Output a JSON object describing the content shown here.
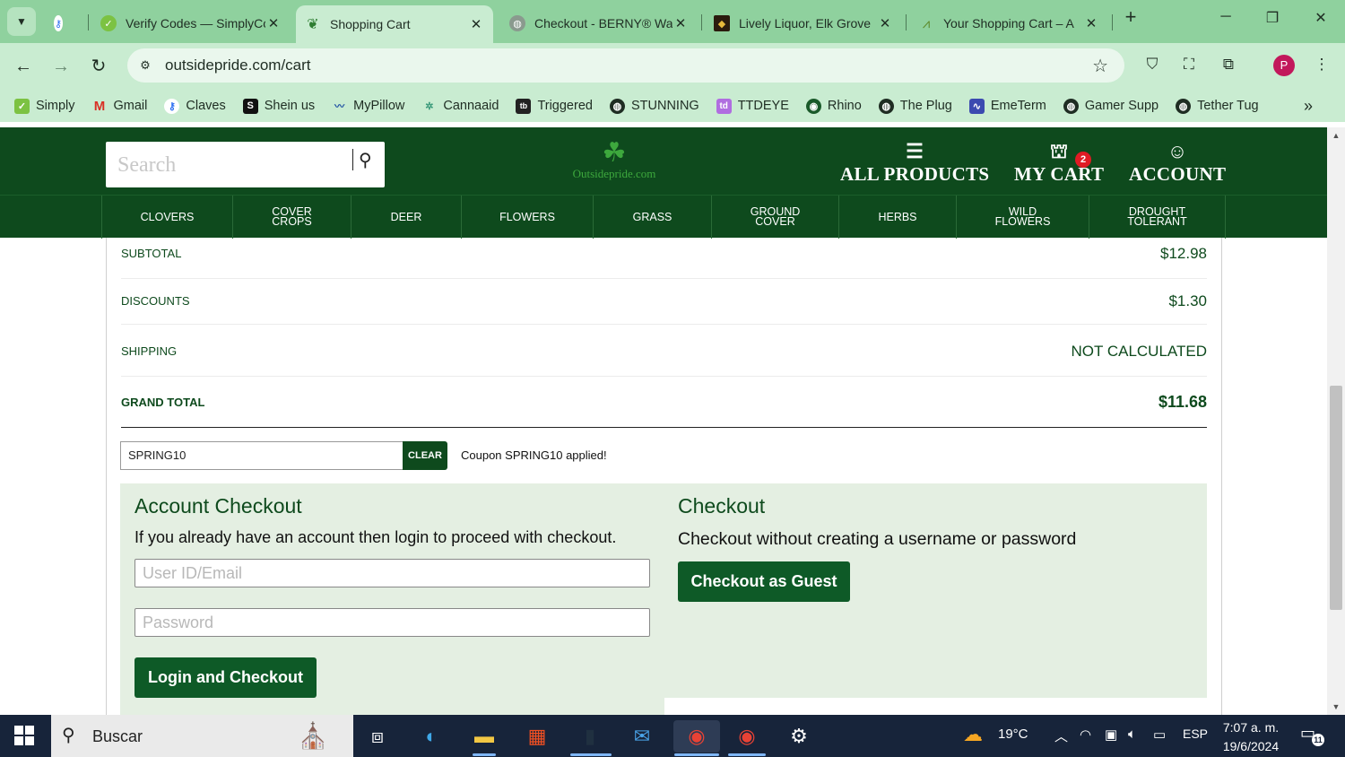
{
  "browser": {
    "tabs": [
      {
        "title": "Verify Codes — SimplyCodes"
      },
      {
        "title": "Shopping Cart"
      },
      {
        "title": "Checkout - BERNY® Walking"
      },
      {
        "title": "Lively Liquor, Elk Grove"
      },
      {
        "title": "Your Shopping Cart – A"
      }
    ],
    "url": "outsidepride.com/cart",
    "profile_initial": "P",
    "bookmarks": [
      {
        "label": "Simply"
      },
      {
        "label": "Gmail"
      },
      {
        "label": "Claves"
      },
      {
        "label": "Shein us"
      },
      {
        "label": "MyPillow"
      },
      {
        "label": "Cannaaid"
      },
      {
        "label": "Triggered"
      },
      {
        "label": "STUNNING"
      },
      {
        "label": "TTDEYE"
      },
      {
        "label": "Rhino"
      },
      {
        "label": "The Plug"
      },
      {
        "label": "EmeTerm"
      },
      {
        "label": "Gamer Supp"
      },
      {
        "label": "Tether Tug"
      }
    ]
  },
  "site": {
    "search_placeholder": "Search",
    "logo_text": "Outsidepride.com",
    "header_links": {
      "all_products": "ALL PRODUCTS",
      "my_cart": "MY CART",
      "account": "ACCOUNT"
    },
    "cart_count": "2",
    "categories": [
      {
        "line1": "CLOVERS",
        "line2": ""
      },
      {
        "line1": "COVER",
        "line2": "CROPS"
      },
      {
        "line1": "DEER",
        "line2": ""
      },
      {
        "line1": "FLOWERS",
        "line2": ""
      },
      {
        "line1": "GRASS",
        "line2": ""
      },
      {
        "line1": "GROUND",
        "line2": "COVER"
      },
      {
        "line1": "HERBS",
        "line2": ""
      },
      {
        "line1": "WILD",
        "line2": "FLOWERS"
      },
      {
        "line1": "DROUGHT",
        "line2": "TOLERANT"
      }
    ]
  },
  "summary": {
    "subtotal": {
      "label": "SUBTOTAL",
      "value": "$12.98"
    },
    "discounts": {
      "label": "DISCOUNTS",
      "value": "$1.30"
    },
    "shipping": {
      "label": "SHIPPING",
      "value": "NOT CALCULATED"
    },
    "grand_total": {
      "label": "GRAND TOTAL",
      "value": "$11.68"
    }
  },
  "coupon": {
    "code": "SPRING10",
    "clear_label": "CLEAR",
    "message": "Coupon SPRING10 applied!"
  },
  "account_checkout": {
    "heading": "Account Checkout",
    "description": "If you already have an account then login to proceed with checkout.",
    "user_placeholder": "User ID/Email",
    "password_placeholder": "Password",
    "button": "Login and Checkout"
  },
  "guest_checkout": {
    "heading": "Checkout",
    "description": "Checkout without creating a username or password",
    "button": "Checkout as Guest"
  },
  "taskbar": {
    "search_label": "Buscar",
    "weather": "19°C",
    "language": "ESP",
    "time": "7:07 a. m.",
    "date": "19/6/2024",
    "notifications": "11"
  },
  "colors": {
    "brand_green": "#0e4a1d",
    "panel_bg": "#e4efe2",
    "chrome_green": "#8fd19e",
    "badge_red": "#e01b24"
  }
}
